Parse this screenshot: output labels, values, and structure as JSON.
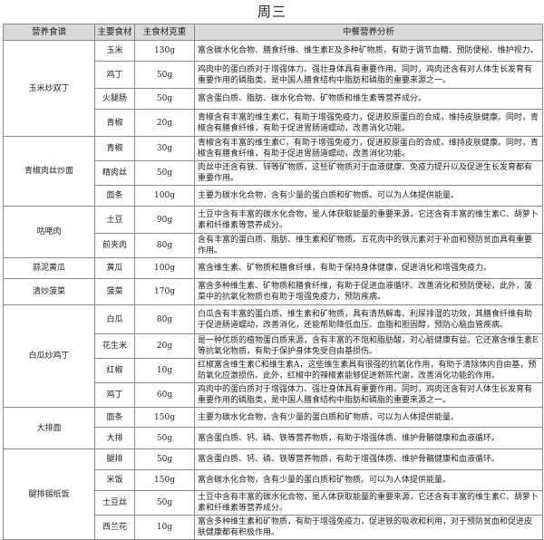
{
  "title": "周三",
  "headers": [
    "营养食谱",
    "主要食材",
    "主食材克重",
    "中餐营养分析"
  ],
  "dishes": [
    {
      "name": "玉米炒双丁",
      "rows": [
        {
          "ingredient": "玉米",
          "weight": "130g",
          "h": 23,
          "analysis": "富含碳水化合物、膳食纤维、维生素E及多种矿物质，有助于调节血糖、预防便秘、维护视力。"
        },
        {
          "ingredient": "鸡丁",
          "weight": "50g",
          "h": 30,
          "analysis": "鸡肉中的蛋白质对于增强体力、强壮身体具有重要作用。同时，鸡肉还含有对人体生长发育有重要作用的磷脂类，是中国人膳食结构中脂肪和磷脂的重要来源之一。"
        },
        {
          "ingredient": "火腿肠",
          "weight": "50g",
          "h": 23,
          "analysis": "富含蛋白质、脂肪、碳水化合物、矿物质和维生素等营养成分。"
        },
        {
          "ingredient": "青椒",
          "weight": "20g",
          "h": 30,
          "analysis": "青椒含有丰富的维生素C，有助于增强免疫力，促进胶原蛋白的合成，维持皮肤健康。同时，青椒含有膳食纤维，有助于促进胃肠道蠕动，改善消化功能。"
        }
      ]
    },
    {
      "name": "青椒肉丝炒面",
      "rows": [
        {
          "ingredient": "青椒",
          "weight": "30g",
          "h": 24,
          "analysis": "青椒含有丰富的维生素C，有助于增强免疫力，促进胶原蛋白的合成，维持皮肤健康。同时，青椒含有膳食纤维，有助于促进胃肠道蠕动，改善消化功能。"
        },
        {
          "ingredient": "精肉丝",
          "weight": "50g",
          "h": 25,
          "analysis": "肉丝中还含有铁、锌等矿物质，这些矿物质对于血液健康、免疫力提升以及促进生长发育都有重要作用。"
        },
        {
          "ingredient": "面条",
          "weight": "100g",
          "h": 23,
          "analysis": "主要为碳水化合物，含有少量的蛋白质和矿物质。可以为人体提供能量。"
        }
      ]
    },
    {
      "name": "咕咾肉",
      "rows": [
        {
          "ingredient": "土豆",
          "weight": "90g",
          "h": 30,
          "analysis": "土豆中含有丰富的碳水化合物，是人体获取能量的重要来源，它还含有丰富的维生素C、胡萝卜素和纤维素等营养成分。"
        },
        {
          "ingredient": "前夹肉",
          "weight": "80g",
          "h": 24,
          "analysis": "含有丰富的蛋白质、脂肪、维生素和矿物质。五花肉中的铁元素对于补血和预防贫血具有重要作用。"
        }
      ]
    },
    {
      "name": "蒜泥黄瓜",
      "rows": [
        {
          "ingredient": "黄瓜",
          "weight": "100g",
          "h": 23,
          "analysis": "富含维生素、矿物质和膳食纤维，有助于保持身体健康，促进消化和增强免疫力。"
        }
      ]
    },
    {
      "name": "清炒菠菜",
      "rows": [
        {
          "ingredient": "菠菜",
          "weight": "170g",
          "h": 29,
          "analysis": "富含多种维生素、矿物质和膳食纤维，有助于促进血液循环、改善消化和预防便秘，此外，菠菜中的抗氧化物质也有助于增强免疫力，预防疾病。"
        }
      ]
    },
    {
      "name": "白瓜炒鸡丁",
      "rows": [
        {
          "ingredient": "白瓜",
          "weight": "80g",
          "h": 32,
          "analysis": "白瓜含有丰富的蛋白质、维生素和矿物质，具有清热解毒、利尿排湿的功效，其膳食纤维有助于促进肠道蠕动，改善消化，还能帮助降低血压、血脂和胆固醇，预防心脑血管疾病。"
        },
        {
          "ingredient": "花生米",
          "weight": "20g",
          "h": 25,
          "analysis": "是一种优质的植物蛋白质来源，含有丰富的不饱和脂肪酸，对心脏健康有益。它还富含维生素E等抗氧化物质，有助于保护身体免受自由基损伤。"
        },
        {
          "ingredient": "红椒",
          "weight": "10g",
          "h": 25,
          "analysis": "红椒富含维生素C和维生素A，这些维生素具有很强的抗氧化作用，有助于清除体内自由基，预防氧化应激损伤。此外，红椒中的辣椒素能够促进新陈代谢，改善消化功能的作用。"
        },
        {
          "ingredient": "鸡丁",
          "weight": "60g",
          "h": 25,
          "analysis": "鸡肉中的蛋白质对于增强体力、强壮身体具有重要作用。同时，鸡肉还含有对人体生长发育有重要作用的磷脂类，是中国人膳食结构中脂肪和磷脂的重要来源之一。"
        }
      ]
    },
    {
      "name": "大排面",
      "rows": [
        {
          "ingredient": "面条",
          "weight": "150g",
          "h": 22,
          "analysis": "主要为碳水化合物，含有少量的蛋白质和矿物质，可以为人体提供能量。"
        },
        {
          "ingredient": "大排",
          "weight": "50g",
          "h": 24,
          "analysis": "富含蛋白质、钙、磷、铁等营养物质，有助于增强体质、维护骨骼健康和血液循环。"
        }
      ]
    },
    {
      "name": "腿排锡纸饭",
      "rows": [
        {
          "ingredient": "腿排",
          "weight": "50g",
          "h": 23,
          "analysis": "富含蛋白质、钙、磷、铁等营养物质，有助于增强体质、维护骨骼健康和血液循环。"
        },
        {
          "ingredient": "米饭",
          "weight": "150g",
          "h": 23,
          "analysis": "富含碳水化合物，含有少量的蛋白质和矿物质。可以为人体提供能量。"
        },
        {
          "ingredient": "土豆丝",
          "weight": "50g",
          "h": 24,
          "analysis": "土豆中含有丰富的碳水化合物，是人体获取能量的重要来源，它还含有丰富的维生素C、胡萝卜素和纤维素等营养成分。"
        },
        {
          "ingredient": "西兰花",
          "weight": "10g",
          "h": 24,
          "analysis": "富含多种维生素和矿物质，有助于增强免疫力，促进铁的吸收和利用，对于预防贫血和促进皮肤健康都有积极作用。"
        }
      ]
    }
  ]
}
